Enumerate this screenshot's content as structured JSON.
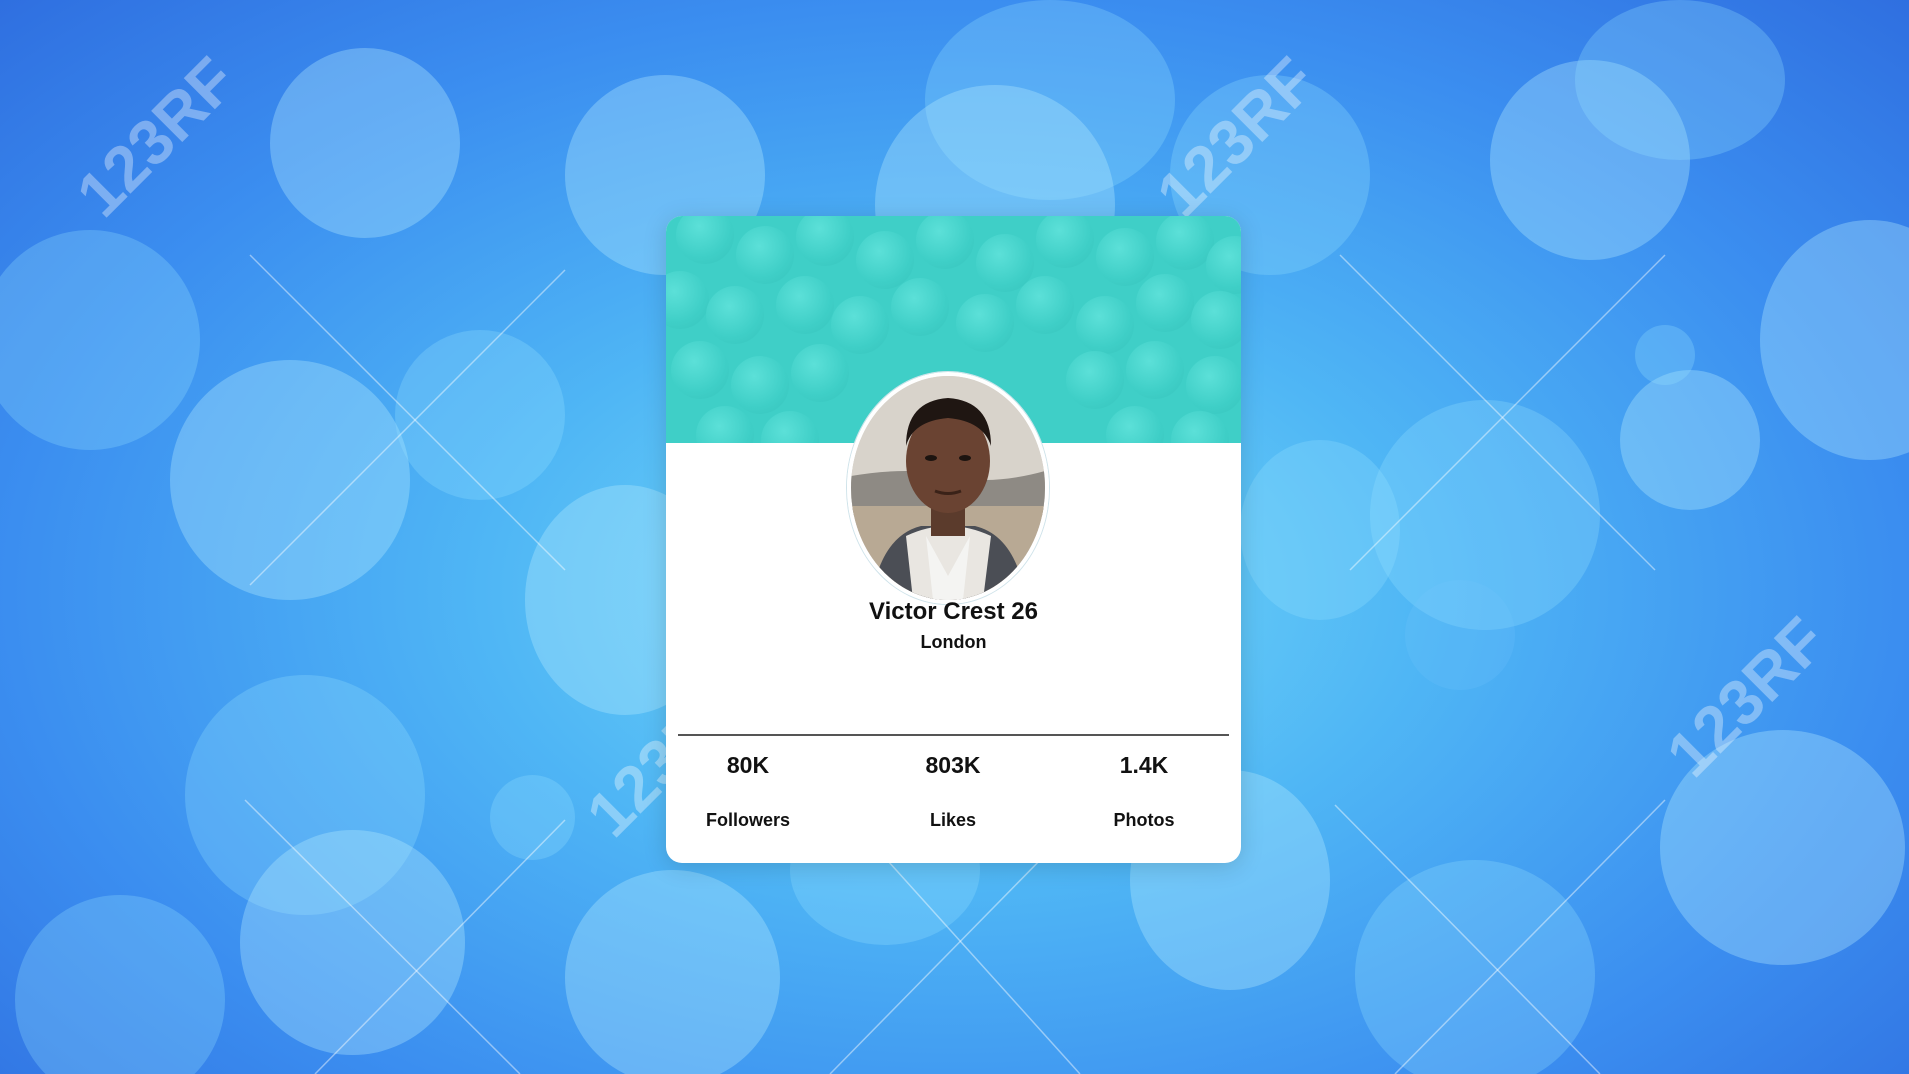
{
  "background": {
    "watermark_text": "123RF",
    "colors": {
      "top": "#2f6fe0",
      "center": "#74d9f7",
      "cover": "#3fcfc7"
    }
  },
  "profile": {
    "name": "Victor Crest 26",
    "location": "London",
    "avatar_icon": "person-photo-icon"
  },
  "stats": [
    {
      "value": "80K",
      "label": "Followers"
    },
    {
      "value": "803K",
      "label": "Likes"
    },
    {
      "value": "1.4K",
      "label": "Photos"
    }
  ]
}
